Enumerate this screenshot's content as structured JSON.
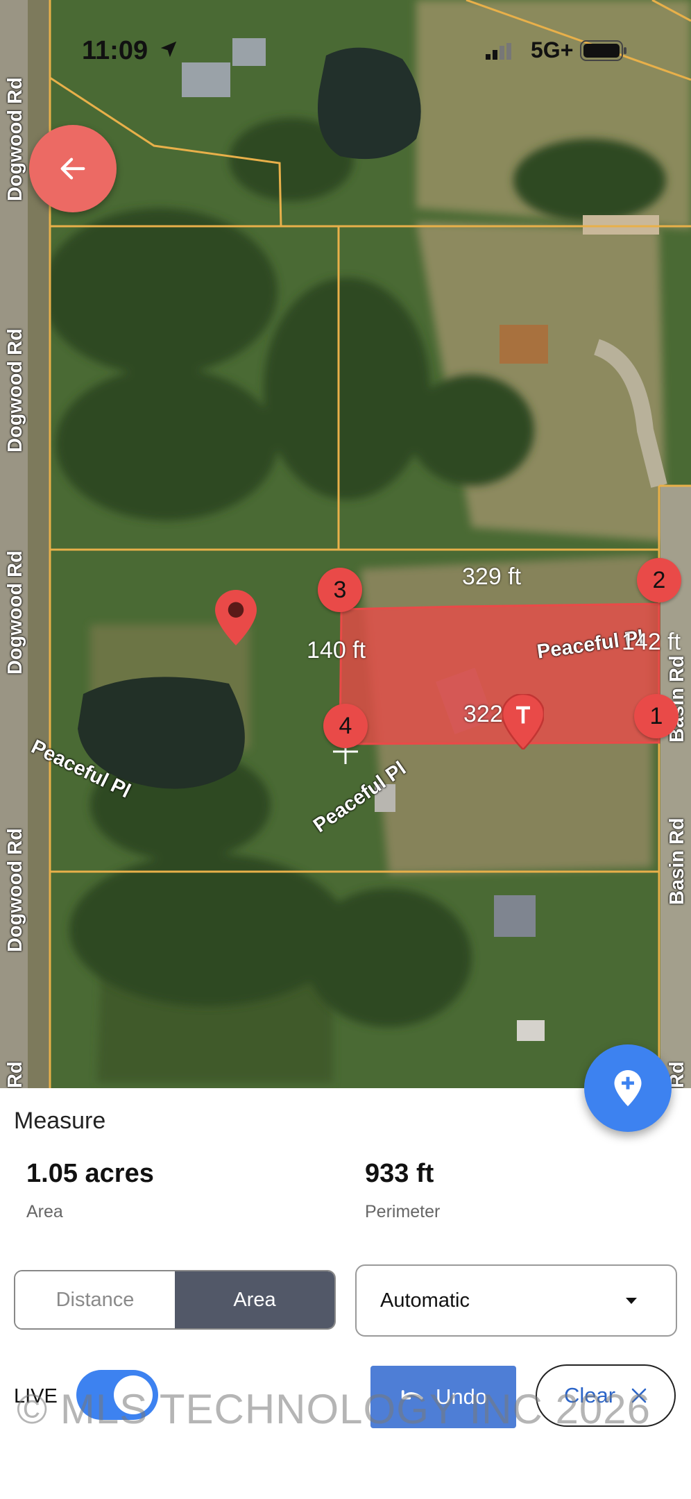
{
  "status_bar": {
    "time": "11:09",
    "network": "5G+"
  },
  "map": {
    "road_labels": {
      "dogwood_1": "Dogwood Rd",
      "dogwood_2": "Dogwood Rd",
      "dogwood_3": "Dogwood Rd",
      "dogwood_4": "Dogwood Rd",
      "dogwood_5": "Rd",
      "peaceful_1": "Peaceful Pl",
      "peaceful_2": "Peaceful Pl",
      "peaceful_3": "Peaceful Pl",
      "basin_1": "Basin Rd",
      "basin_2": "Basin Rd",
      "basin_3": "Rd"
    },
    "measurements": {
      "top": "329 ft",
      "left": "140 ft",
      "right": "142 ft",
      "bottom": "322"
    },
    "vertices": [
      "1",
      "2",
      "3",
      "4"
    ],
    "colors": {
      "polygon_fill": "#e94a48",
      "parcel_line": "#e8b04a",
      "accent": "#3d82f0",
      "back_button": "#ec6a64"
    },
    "icons": [
      "back-arrow-icon",
      "location-pin-icon",
      "add-pin-icon"
    ]
  },
  "panel": {
    "title": "Measure",
    "area_value": "1.05 acres",
    "area_label": "Area",
    "perimeter_value": "933 ft",
    "perimeter_label": "Perimeter",
    "mode_distance": "Distance",
    "mode_area": "Area",
    "selected_mode": "Area",
    "unit_select": "Automatic",
    "live_label": "LIVE",
    "live_on": true,
    "undo_label": "Undo",
    "clear_label": "Clear"
  },
  "watermark": "© MLS TECHNOLOGY INC 2026"
}
